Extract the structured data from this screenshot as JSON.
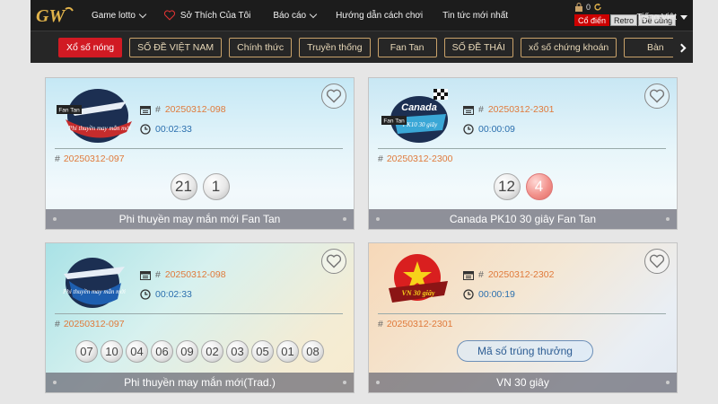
{
  "header": {
    "logo_text": "GW",
    "nav": [
      {
        "label": "Game lotto",
        "has_dropdown": true
      },
      {
        "label": "Sở Thích Của Tôi",
        "has_dropdown": false
      },
      {
        "label": "Báo cáo",
        "has_dropdown": true
      },
      {
        "label": "Hướng dẫn cách chơi",
        "has_dropdown": false
      },
      {
        "label": "Tin tức mới nhất",
        "has_dropdown": false
      }
    ],
    "balance": "0",
    "styles": [
      "Cổ điển",
      "Retro",
      "Dễ dùng"
    ],
    "active_style": "Cổ điển",
    "language": "Tiếng Việt"
  },
  "tabs": [
    "Xổ số nóng",
    "SỐ ĐỀ VIỆT NAM",
    "Chính thức",
    "Truyền thống",
    "Fan Tan",
    "SỐ ĐỀ THÁI",
    "xổ số chứng khoán",
    "Bàn"
  ],
  "active_tab": "Xổ số nóng",
  "cards": [
    {
      "logo_text": "Phi thuyền may mắn mới",
      "logo_tag": "Fan Tan",
      "current_issue": "20250312-098",
      "countdown": "00:02:33",
      "previous_issue": "20250312-097",
      "results": [
        "21",
        "1"
      ],
      "title": "Phi thuyền may mắn mới Fan Tan"
    },
    {
      "logo_text": "Canada PK10 30 giây",
      "logo_tag": "Fan Tan",
      "current_issue": "20250312-2301",
      "countdown": "00:00:09",
      "previous_issue": "20250312-2300",
      "results": [
        "12",
        "4"
      ],
      "title": "Canada PK10 30 giây Fan Tan"
    },
    {
      "logo_text": "Phi thuyền may mắn mới",
      "current_issue": "20250312-098",
      "countdown": "00:02:33",
      "previous_issue": "20250312-097",
      "results": [
        "07",
        "10",
        "04",
        "06",
        "09",
        "02",
        "03",
        "05",
        "01",
        "08"
      ],
      "title": "Phi thuyền may mắn mới(Trad.)"
    },
    {
      "logo_text": "VN 30 giây",
      "current_issue": "20250312-2302",
      "countdown": "00:00:19",
      "previous_issue": "20250312-2301",
      "button_label": "Mã số trúng thưởng",
      "title": "VN 30 giây"
    }
  ],
  "colors": {
    "accent_red": "#d11a23",
    "tab_border": "#c9a26a",
    "issue_orange": "#e07a3b",
    "timer_blue": "#2b6fae"
  }
}
